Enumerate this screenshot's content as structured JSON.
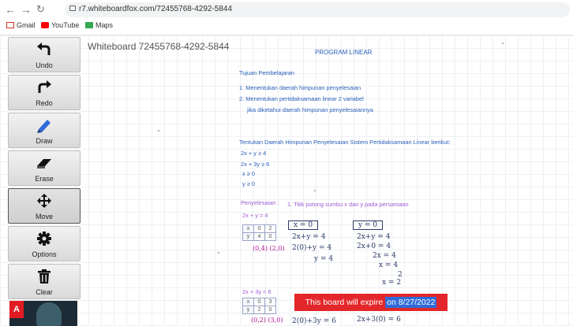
{
  "browser": {
    "url": "r7.whiteboardfox.com/72455768-4292-5844",
    "bookmarks": [
      {
        "label": "Gmail",
        "icon": "gmail-icon",
        "color": "#d93025"
      },
      {
        "label": "YouTube",
        "icon": "youtube-icon",
        "color": "#ff0000"
      },
      {
        "label": "Maps",
        "icon": "maps-icon",
        "color": "#34a853"
      }
    ]
  },
  "toolbar": {
    "undo": "Undo",
    "redo": "Redo",
    "draw": "Draw",
    "erase": "Erase",
    "move": "Move",
    "options": "Options",
    "clear": "Clear",
    "active": "move"
  },
  "board": {
    "title": "Whiteboard 72455768-4292-5844",
    "heading": "PROGRAM LINEAR",
    "tujuan_title": "Tujuan Pembelajaran",
    "tujuan_1": "1. Menentukan daerah himpunan penyelesaian",
    "tujuan_2": "2. Menentukan pertidaksamaan linear 2 variabel",
    "tujuan_2b": "jika diketahui daerah himpunan penyelesaiannya",
    "soal": "Tentukan Daerah Himpunan Penyelesaian Sistem Pertidaksamaan Linear berikut:",
    "ineq_1": "2x + y ≥ 4",
    "ineq_2": "2x + 3y ≥ 6",
    "ineq_3": "x ≥ 0",
    "ineq_4": "y ≥ 0",
    "penyelesaian": "Penyelesaian :",
    "step_1": "1. Titik potong sumbu x dan y  pada persamaan",
    "eq_a": "2x + y = 4",
    "eq_b": "2x + 3y = 6",
    "table_a": {
      "x": [
        "x",
        "0",
        "2"
      ],
      "y": [
        "y",
        "4",
        "0"
      ]
    },
    "table_b": {
      "x": [
        "x",
        "0",
        "3"
      ],
      "y": [
        "y",
        "2",
        "0"
      ]
    },
    "points_a": "(0,4) (2,0)",
    "points_b": "(0,2) (3,0)",
    "hw_x0": "x = 0",
    "hw_y0": "y = 0",
    "hw_a1": "2x+y = 4",
    "hw_a2": "2(0)+y = 4",
    "hw_a3": "y = 4",
    "hw_b1": "2x+y = 4",
    "hw_b2": "2x+0 = 4",
    "hw_b3": "2x = 4",
    "hw_b4": "x = 4",
    "hw_b5": "2",
    "hw_b6": "x = 2",
    "hw_c1": "2(0)+3y = 6",
    "hw_c2": "2x+3(0) = 6"
  },
  "banner": {
    "text": "This board will expire",
    "date": "on 8/27/2022",
    "color": "#e3262a"
  },
  "ad": {
    "brand": "A"
  }
}
